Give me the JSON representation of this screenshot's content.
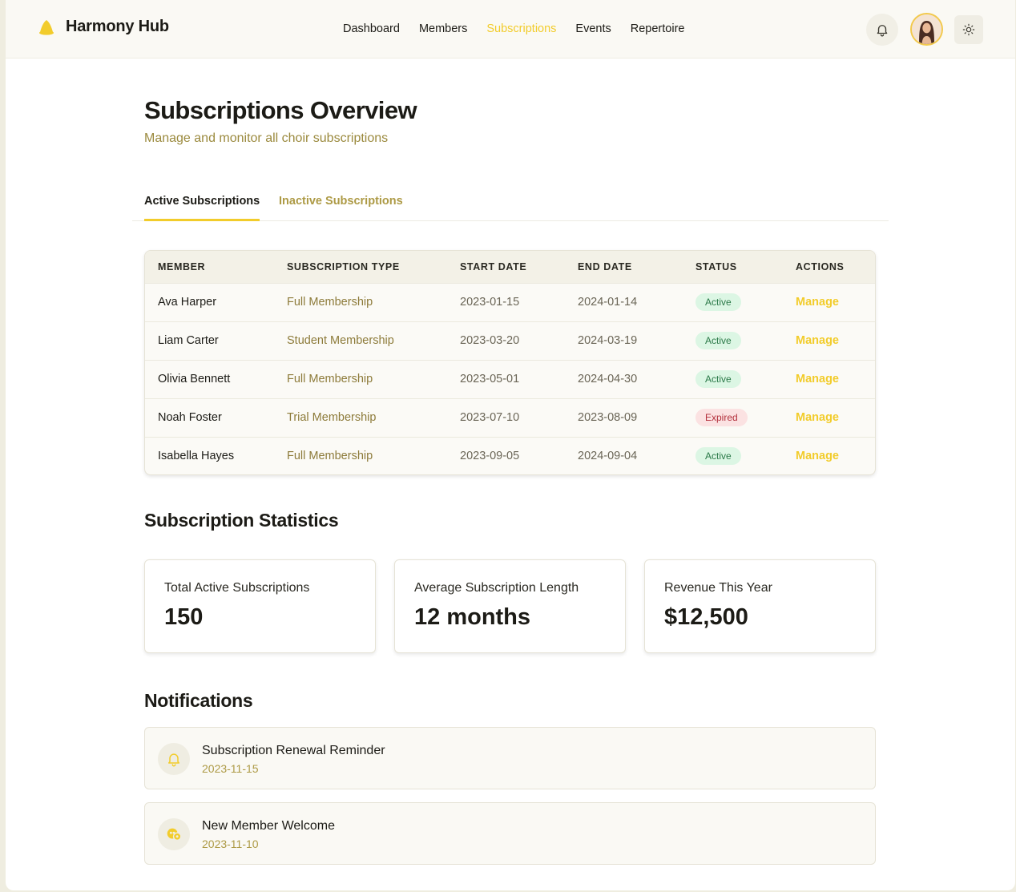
{
  "app": {
    "name": "Harmony Hub",
    "accent": "#f2cc2b"
  },
  "nav": [
    {
      "label": "Dashboard",
      "active": false
    },
    {
      "label": "Members",
      "active": false
    },
    {
      "label": "Subscriptions",
      "active": true
    },
    {
      "label": "Events",
      "active": false
    },
    {
      "label": "Repertoire",
      "active": false
    }
  ],
  "header_icons": {
    "notifications": "bell-icon",
    "avatar": "user-avatar",
    "theme": "sun-icon"
  },
  "page": {
    "title": "Subscriptions Overview",
    "subtitle": "Manage and monitor all choir subscriptions"
  },
  "tabs": [
    {
      "label": "Active Subscriptions",
      "active": true
    },
    {
      "label": "Inactive Subscriptions",
      "active": false
    }
  ],
  "table": {
    "columns": [
      "MEMBER",
      "SUBSCRIPTION TYPE",
      "START DATE",
      "END DATE",
      "STATUS",
      "ACTIONS"
    ],
    "rows": [
      {
        "member": "Ava Harper",
        "type": "Full Membership",
        "start": "2023-01-15",
        "end": "2024-01-14",
        "status": "Active",
        "action": "Manage"
      },
      {
        "member": "Liam Carter",
        "type": "Student Membership",
        "start": "2023-03-20",
        "end": "2024-03-19",
        "status": "Active",
        "action": "Manage"
      },
      {
        "member": "Olivia Bennett",
        "type": "Full Membership",
        "start": "2023-05-01",
        "end": "2024-04-30",
        "status": "Active",
        "action": "Manage"
      },
      {
        "member": "Noah Foster",
        "type": "Trial Membership",
        "start": "2023-07-10",
        "end": "2023-08-09",
        "status": "Expired",
        "action": "Manage"
      },
      {
        "member": "Isabella Hayes",
        "type": "Full Membership",
        "start": "2023-09-05",
        "end": "2024-09-04",
        "status": "Active",
        "action": "Manage"
      }
    ]
  },
  "stats": {
    "title": "Subscription Statistics",
    "cards": [
      {
        "label": "Total Active Subscriptions",
        "value": "150"
      },
      {
        "label": "Average Subscription Length",
        "value": "12 months"
      },
      {
        "label": "Revenue This Year",
        "value": "$12,500"
      }
    ]
  },
  "notifications": {
    "title": "Notifications",
    "items": [
      {
        "title": "Subscription Renewal Reminder",
        "date": "2023-11-15",
        "icon": "bell-icon"
      },
      {
        "title": "New Member Welcome",
        "date": "2023-11-10",
        "icon": "welcome-icon"
      }
    ]
  }
}
